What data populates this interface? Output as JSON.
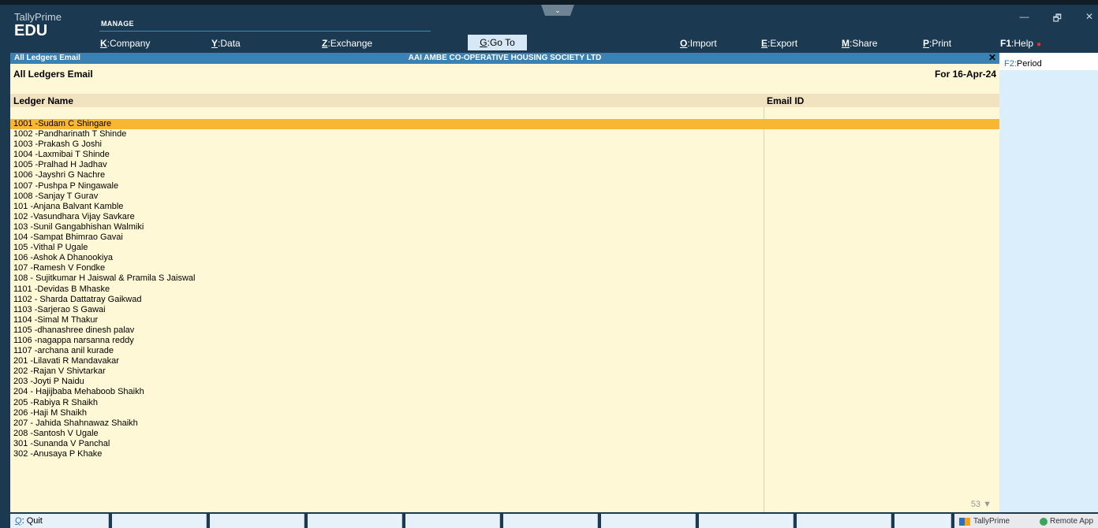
{
  "header": {
    "product": "TallyPrime",
    "edition": "EDU",
    "group_label": "MANAGE",
    "menu": [
      {
        "key": "K",
        "label": "Company"
      },
      {
        "key": "Y",
        "label": "Data"
      },
      {
        "key": "Z",
        "label": "Exchange"
      },
      {
        "key": "G",
        "label": "Go To"
      },
      {
        "key": "O",
        "label": "Import"
      },
      {
        "key": "E",
        "label": "Export"
      },
      {
        "key": "M",
        "label": "Share"
      },
      {
        "key": "P",
        "label": "Print"
      },
      {
        "key": "F1",
        "label": "Help"
      }
    ],
    "window_controls": {
      "minimize": "—",
      "restore": "🗗",
      "close": "✕"
    }
  },
  "report": {
    "small_title": "All Ledgers Email",
    "company": "AAI AMBE CO-OPERATIVE HOUSING SOCIETY LTD",
    "close_symbol": "✕",
    "heading": "All Ledgers Email",
    "period": "For 16-Apr-24",
    "columns": {
      "ledger": "Ledger Name",
      "email": "Email ID"
    },
    "rows": [
      "1001 -Sudam C Shingare",
      "1002 -Pandharinath T Shinde",
      "1003 -Prakash G Joshi",
      "1004 -Laxmibai T Shinde",
      "1005 -Pralhad H Jadhav",
      "1006 -Jayshri G Nachre",
      "1007 -Pushpa P Ningawale",
      "1008 -Sanjay T Gurav",
      "101 -Anjana Balvant Kamble",
      "102 -Vasundhara Vijay Savkare",
      "103 -Sunil Gangabhishan Walmiki",
      "104 -Sampat Bhimrao Gavai",
      "105 -Vithal P Ugale",
      "106 -Ashok A Dhanookiya",
      "107 -Ramesh V Fondke",
      "108 - Sujitkumar H Jaiswal & Pramila S Jaiswal",
      "1101 -Devidas B Mhaske",
      "1102 - Sharda Dattatray Gaikwad",
      "1103 -Sarjerao S Gawai",
      "1104 -Simal M Thakur",
      "1105 -dhanashree dinesh palav",
      "1106 -nagappa narsanna reddy",
      "1107 -archana anil kurade",
      "201 -Lilavati R Mandavakar",
      "202 -Rajan V Shivtarkar",
      "203 -Joyti P Naidu",
      "204 - Hajijbaba Mehaboob Shaikh",
      "205 -Rabiya R Shaikh",
      "206 -Haji M Shaikh",
      "207 - Jahida Shahnawaz Shaikh",
      "208 -Santosh V Ugale",
      "301 -Sunanda V Panchal",
      "302 -Anusaya P Khake"
    ],
    "more_count": "53 ▼"
  },
  "sidepanel": {
    "period_key": "F2:",
    "period_label": "Period"
  },
  "footer": {
    "quit_key": "Q",
    "quit_label": "Quit"
  },
  "taskbar": {
    "tally": "TallyPrime",
    "remote": "Remote App"
  },
  "colors": {
    "header_bg": "#1b3a52",
    "title_bar": "#3b82b4",
    "panel_bg": "#fff8d6",
    "selected_row": "#f7b733"
  }
}
